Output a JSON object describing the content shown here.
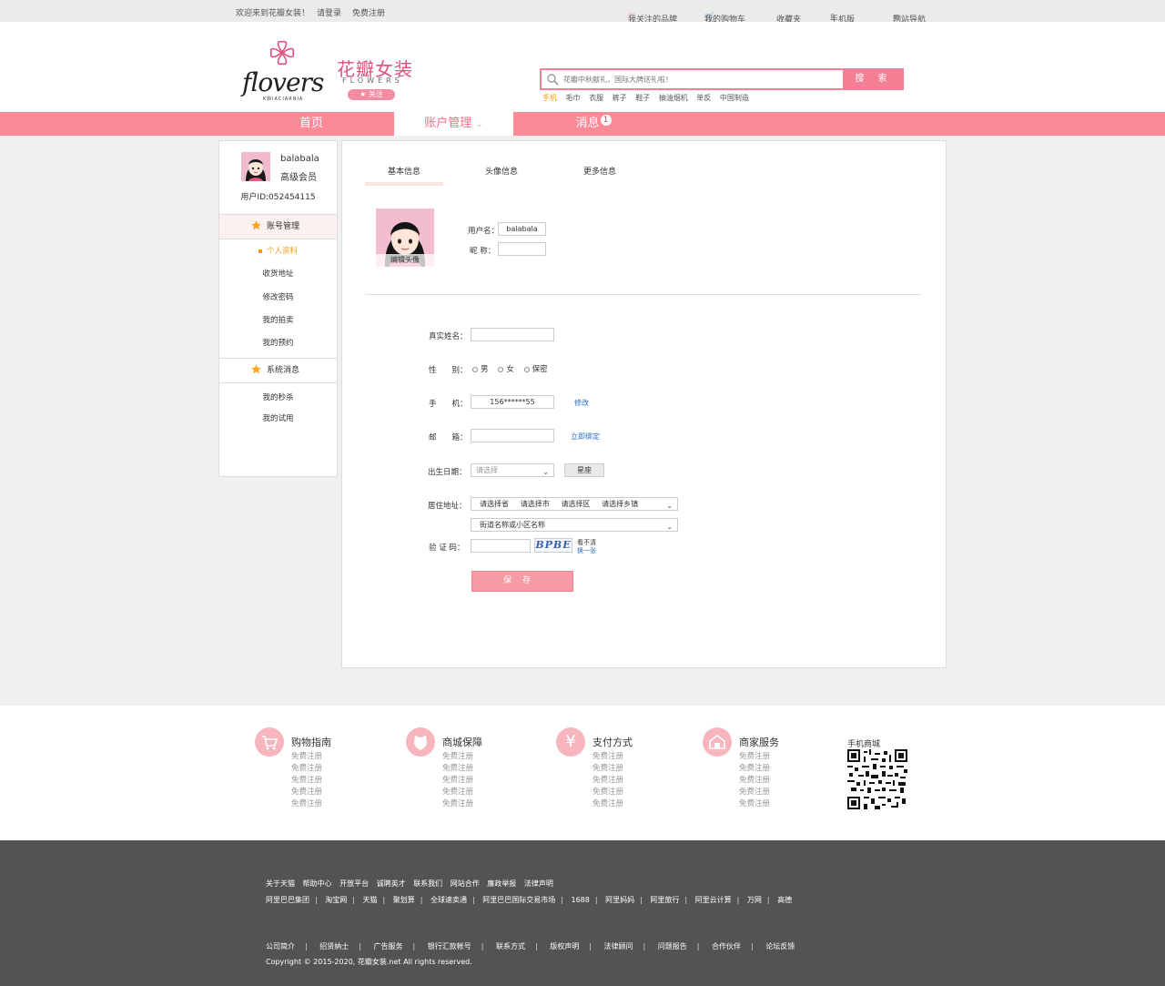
{
  "topbar": {
    "welcome": "欢迎来到花瓣女装！",
    "login": "请登录",
    "register": "免费注册",
    "brands": "我关注的品牌",
    "cart": "我的购物车",
    "favorites": "收藏夹",
    "mobile": "手机版",
    "sitemap": "网站导航"
  },
  "header": {
    "logo_word": "flovers",
    "logo_sub": "KWIACIARNIA",
    "brand_cn": "花瓣女装",
    "brand_en": "FLOWERS",
    "follow": "关注",
    "search_placeholder": "花瓣中秋献礼，国际大牌送礼啦！",
    "search_button": "搜 索",
    "hotwords": [
      "手机",
      "毛巾",
      "衣服",
      "裤子",
      "鞋子",
      "抽油烟机",
      "单反",
      "中国制造"
    ]
  },
  "nav": {
    "home": "首页",
    "account": "账户管理",
    "messages": "消息",
    "message_count": "1"
  },
  "sidebar": {
    "username": "balabala",
    "level": "高级会员",
    "user_id": "用户ID:052454115",
    "section1": "账号管理",
    "items1": [
      "个人资料",
      "收货地址",
      "修改密码",
      "我的拍卖",
      "我的预约"
    ],
    "section2": "系统消息",
    "items2": [
      "我的秒杀",
      "我的试用"
    ]
  },
  "panel": {
    "tabs": [
      "基本信息",
      "头像信息",
      "更多信息"
    ],
    "edit_avatar": "编辑头像",
    "username_label": "用户名：",
    "username_value": "balabala",
    "nickname_label": "昵  称：",
    "realname_label": "真实姓名：",
    "gender_label": "性　　别：",
    "gender_options": [
      "男",
      "女",
      "保密"
    ],
    "phone_label": "手　　机：",
    "phone_value": "156******55",
    "phone_edit": "修改",
    "email_label": "邮　　箱：",
    "email_bind": "立即绑定",
    "birth_label": "出生日期：",
    "birth_placeholder": "请选择",
    "zodiac_button": "星座",
    "address_label": "居住地址：",
    "address_parts": [
      "请选择省",
      "请选择市",
      "请选择区",
      "请选择乡镇"
    ],
    "street_placeholder": "街道名称或小区名称",
    "captcha_label": "验 证 码：",
    "captcha_text": "BPBE",
    "captcha_unclear": "看不清",
    "captcha_refresh": "换一张",
    "save": "保存"
  },
  "footer": {
    "services": [
      {
        "title": "购物指南",
        "items": [
          "免费注册",
          "免费注册",
          "免费注册",
          "免费注册",
          "免费注册"
        ]
      },
      {
        "title": "商城保障",
        "items": [
          "免费注册",
          "免费注册",
          "免费注册",
          "免费注册",
          "免费注册"
        ]
      },
      {
        "title": "支付方式",
        "items": [
          "免费注册",
          "免费注册",
          "免费注册",
          "免费注册",
          "免费注册"
        ]
      },
      {
        "title": "商家服务",
        "items": [
          "免费注册",
          "免费注册",
          "免费注册",
          "免费注册",
          "免费注册"
        ]
      }
    ],
    "qr_title": "手机商城",
    "links_row1": [
      "关于天猫",
      "帮助中心",
      "开放平台",
      "诚聘英才",
      "联系我们",
      "网站合作",
      "廉政举报",
      "法律声明"
    ],
    "links_row2": [
      "阿里巴巴集团",
      "淘宝网",
      "天猫",
      "聚划算",
      "全球速卖通",
      "阿里巴巴国际交易市场",
      "1688",
      "阿里妈妈",
      "阿里旅行",
      "阿里云计算",
      "万网",
      "高德"
    ],
    "bottom_links": [
      "公司简介",
      "招贤纳士",
      "广告服务",
      "银行汇款帐号",
      "联系方式",
      "版权声明",
      "法律顾问",
      "问题报告",
      "合作伙伴",
      "论坛反馈"
    ],
    "copyright": "Copyright © 2015-2020, 花瓣女装.net All rights reserved."
  },
  "colors": {
    "accent": "#fb8a96",
    "accent_dark": "#f47e93",
    "link": "#2a6fbf",
    "active_item": "#f39c12"
  }
}
